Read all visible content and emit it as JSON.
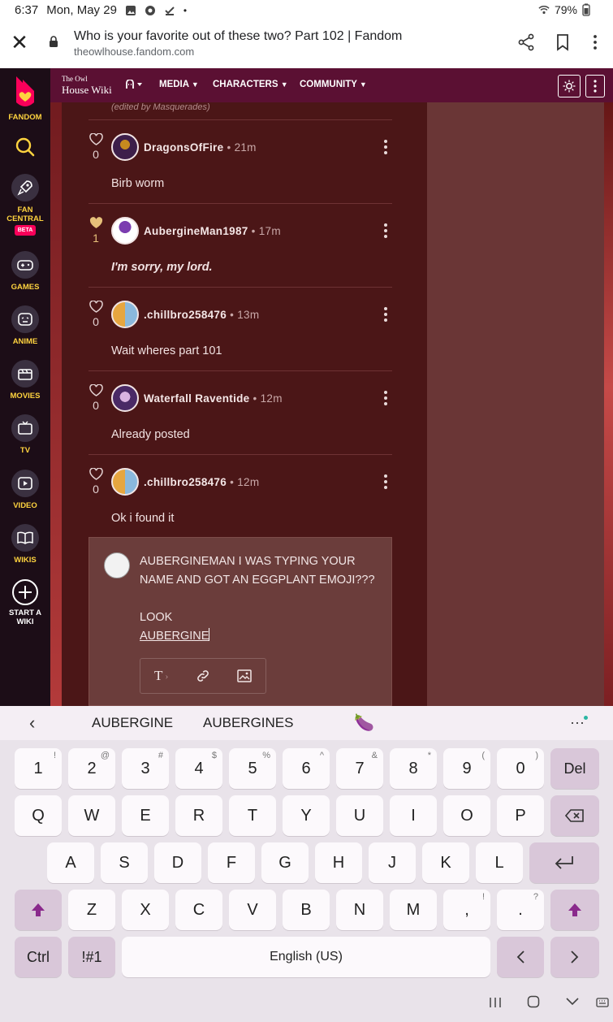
{
  "status_bar": {
    "time": "6:37",
    "date": "Mon, May 29",
    "battery": "79%"
  },
  "browser": {
    "page_title": "Who is your favorite out of these two? Part 102 | Fandom",
    "domain": "theowlhouse.fandom.com"
  },
  "rail": {
    "brand": "FANDOM",
    "fan_central_line1": "FAN",
    "fan_central_line2": "CENTRAL",
    "beta": "BETA",
    "games": "GAMES",
    "anime": "ANIME",
    "movies": "MOVIES",
    "tv": "TV",
    "video": "VIDEO",
    "wikis": "WIKIS",
    "start_line1": "START A",
    "start_line2": "WIKI"
  },
  "wiki_nav": {
    "logo_line1": "The Owl",
    "logo_line2": "House Wiki",
    "media": "MEDIA",
    "characters": "CHARACTERS",
    "community": "COMMUNITY"
  },
  "edited_note": "(edited by Masquerades)",
  "comments": [
    {
      "likes": "0",
      "user": "DragonsOfFire",
      "time": "21m",
      "text": "Birb worm"
    },
    {
      "likes": "1",
      "user": "AubergineMan1987",
      "time": "17m",
      "text": "I'm sorry, my lord."
    },
    {
      "likes": "0",
      "user": ".chillbro258476",
      "time": "13m",
      "text": "Wait wheres part 101"
    },
    {
      "likes": "0",
      "user": "Waterfall Raventide",
      "time": "12m",
      "text": "Already posted"
    },
    {
      "likes": "0",
      "user": ".chillbro258476",
      "time": "12m",
      "text": "Ok i found it"
    }
  ],
  "reply": {
    "line1": "AUBERGINEMAN I WAS TYPING YOUR",
    "line2": "NAME AND GOT AN EGGPLANT EMOJI???",
    "line3": "LOOK",
    "line4": "AUBERGINE"
  },
  "keyboard": {
    "suggestions": [
      "AUBERGINE",
      "AUBERGINES",
      "🍆"
    ],
    "row_numbers": [
      {
        "k": "1",
        "s": "!"
      },
      {
        "k": "2",
        "s": "@"
      },
      {
        "k": "3",
        "s": "#"
      },
      {
        "k": "4",
        "s": "$"
      },
      {
        "k": "5",
        "s": "%"
      },
      {
        "k": "6",
        "s": "^"
      },
      {
        "k": "7",
        "s": "&"
      },
      {
        "k": "8",
        "s": "*"
      },
      {
        "k": "9",
        "s": "("
      },
      {
        "k": "0",
        "s": ")"
      }
    ],
    "del": "Del",
    "row_q": [
      "Q",
      "W",
      "E",
      "R",
      "T",
      "Y",
      "U",
      "I",
      "O",
      "P"
    ],
    "row_a": [
      "A",
      "S",
      "D",
      "F",
      "G",
      "H",
      "J",
      "K",
      "L"
    ],
    "row_z": [
      "Z",
      "X",
      "C",
      "V",
      "B",
      "N",
      "M"
    ],
    "comma": ",",
    "comma_sup": "!",
    "period": ".",
    "period_sup": "?",
    "ctrl": "Ctrl",
    "sym": "!#1",
    "space": "English (US)"
  }
}
